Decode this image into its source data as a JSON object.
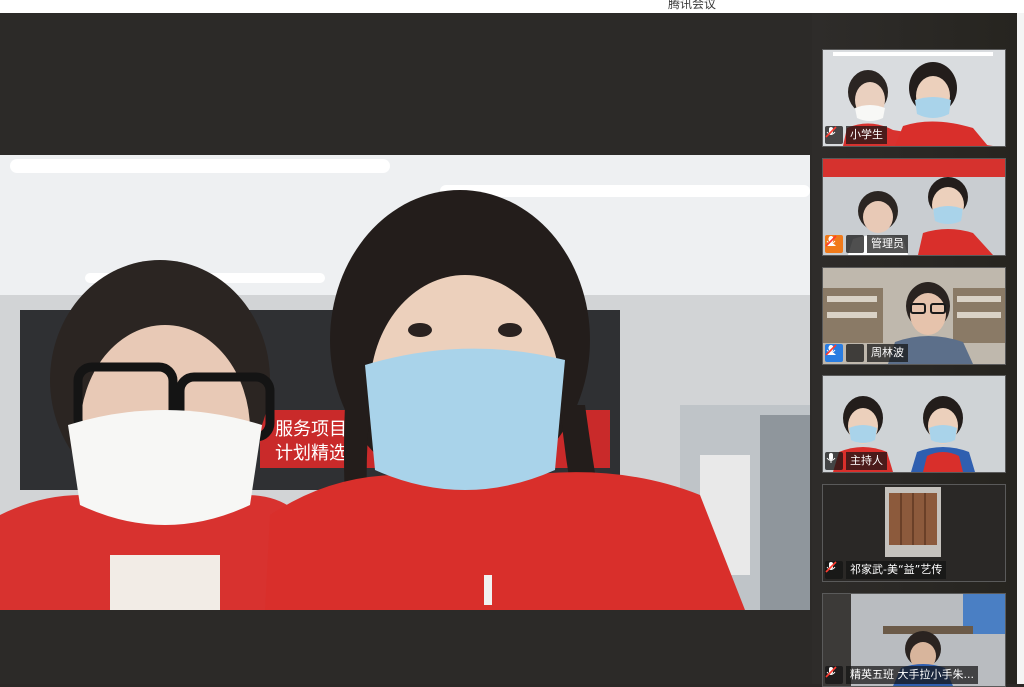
{
  "window": {
    "title": "腾讯会议"
  },
  "main_video": {
    "speaker": "小学生",
    "banner_text_line1": "服务项目",
    "banner_text_line2": "计划精选"
  },
  "participants": [
    {
      "name": "小学生",
      "role_icon": null,
      "mic": "muted"
    },
    {
      "name": "管理员",
      "role_icon": "admin-icon",
      "mic": "muted"
    },
    {
      "name": "周林波",
      "role_icon": "user-icon",
      "mic": "muted"
    },
    {
      "name": "主持人",
      "role_icon": null,
      "mic": "active"
    },
    {
      "name": "祁家武-美“益”艺传",
      "role_icon": null,
      "mic": "muted"
    },
    {
      "name": "精英五班 大手拉小手朱...",
      "role_icon": null,
      "mic": "muted"
    }
  ],
  "colors": {
    "accent_red": "#e0312c",
    "mask_blue": "#a9d3ea",
    "admin_orange": "#f07a1a",
    "user_blue": "#2a7de1"
  }
}
